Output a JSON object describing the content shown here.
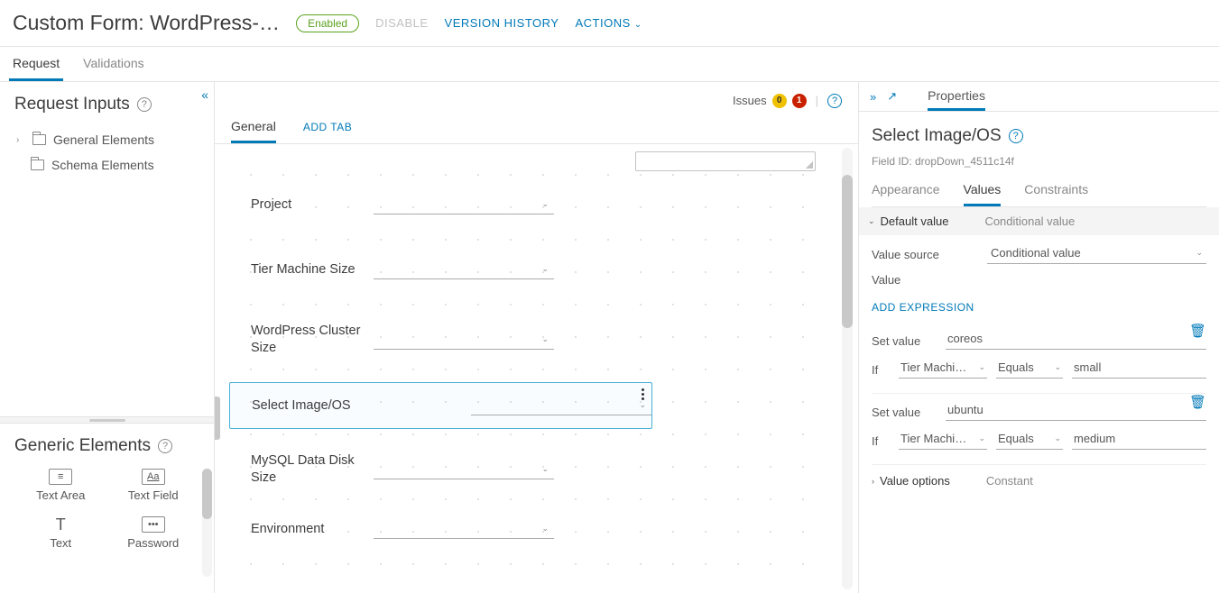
{
  "header": {
    "title": "Custom Form: WordPress-…",
    "status_badge": "Enabled",
    "disable_btn": "DISABLE",
    "version_btn": "VERSION HISTORY",
    "actions_btn": "ACTIONS"
  },
  "subtabs": {
    "request": "Request",
    "validations": "Validations"
  },
  "left_panel": {
    "inputs_title": "Request Inputs",
    "tree": {
      "general": "General Elements",
      "schema": "Schema Elements"
    },
    "generic_title": "Generic Elements",
    "items": {
      "textarea": "Text Area",
      "textfield": "Text Field",
      "text": "Text",
      "password": "Password"
    }
  },
  "canvas": {
    "issues_label": "Issues",
    "warn_count": "0",
    "err_count": "1",
    "tabs": {
      "general": "General",
      "add": "ADD TAB"
    },
    "fields": {
      "project": "Project",
      "tierSize": "Tier Machine Size",
      "wpCluster": "WordPress Cluster Size",
      "imageOS": "Select Image/OS",
      "mysqlDisk": "MySQL Data Disk Size",
      "environment": "Environment"
    }
  },
  "right": {
    "tab": "Properties",
    "title": "Select Image/OS",
    "field_id": "Field ID: dropDown_4511c14f",
    "ptabs": {
      "appearance": "Appearance",
      "values": "Values",
      "constraints": "Constraints"
    },
    "toggles": {
      "default": "Default value",
      "conditional": "Conditional value"
    },
    "value_source_label": "Value source",
    "value_source": "Conditional value",
    "value_label": "Value",
    "add_expr": "ADD EXPRESSION",
    "set_value_label": "Set value",
    "if_label": "If",
    "expr1": {
      "set": "coreos",
      "field": "Tier Machi…",
      "op": "Equals",
      "val": "small"
    },
    "expr2": {
      "set": "ubuntu",
      "field": "Tier Machi…",
      "op": "Equals",
      "val": "medium"
    },
    "value_options": "Value options",
    "constant": "Constant"
  }
}
